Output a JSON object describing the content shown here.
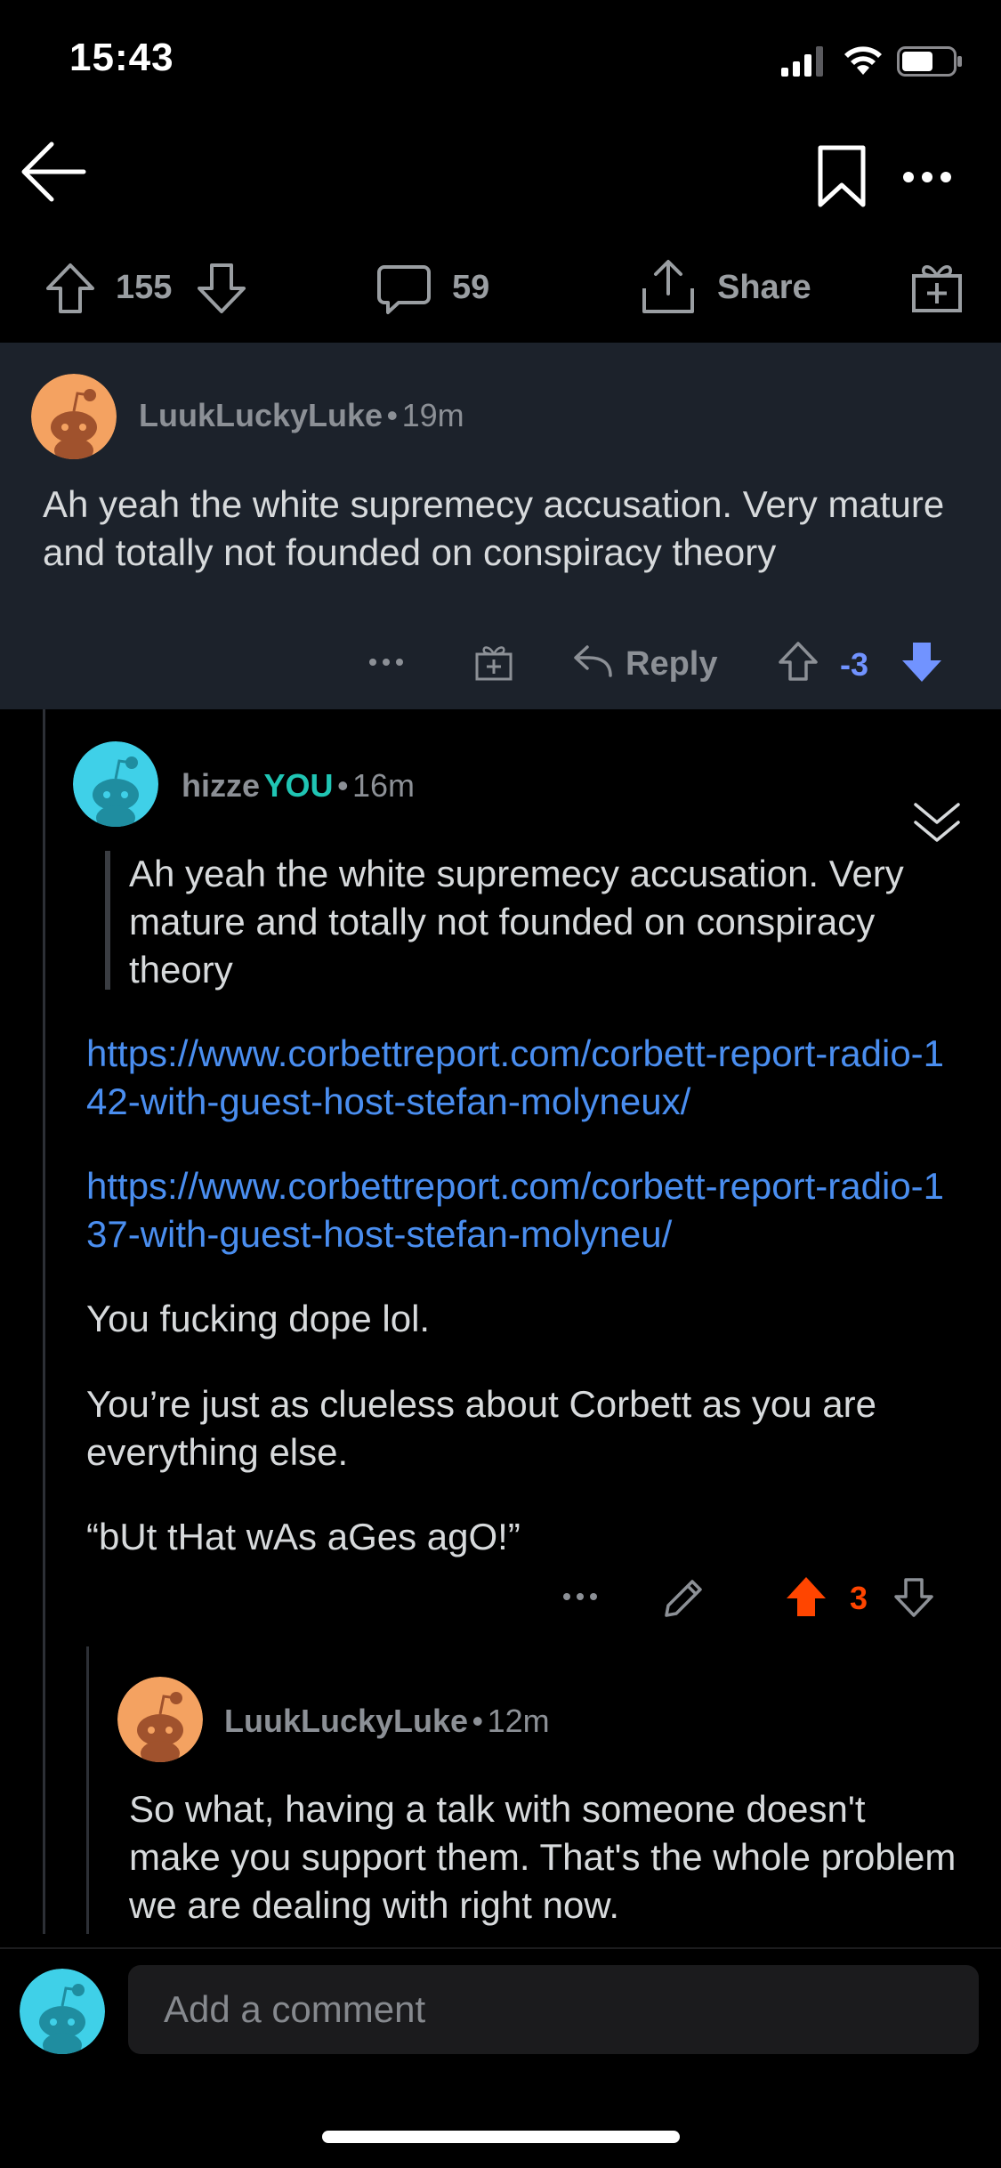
{
  "status_bar": {
    "time": "15:43"
  },
  "action_bar": {
    "upvotes": "155",
    "comments": "59",
    "share_label": "Share"
  },
  "comments": [
    {
      "username": "LuukLuckyLuke",
      "separator": "•",
      "time": "19m",
      "body": "Ah yeah the white supremecy accusation. Very mature and totally not founded on conspiracy theory",
      "reply_label": "Reply",
      "score": "-3",
      "vote_state": "downvoted"
    },
    {
      "username": "hizze",
      "you_badge": "YOU",
      "separator": "•",
      "time": "16m",
      "quote": "Ah yeah the white supremecy accusation. Very mature and totally not founded on conspiracy theory",
      "link1": "https://www.corbettreport.com/corbett-report-radio-142-with-guest-host-stefan-molyneux/",
      "link2": "https://www.corbettreport.com/corbett-report-radio-137-with-guest-host-stefan-molyneu/",
      "para1": "You fucking dope lol.",
      "para2": "You’re just as clueless about Corbett as you are everything else.",
      "para3": "“bUt tHat wAs aGes agO!”",
      "score": "3",
      "vote_state": "upvoted"
    },
    {
      "username": "LuukLuckyLuke",
      "separator": "•",
      "time": "12m",
      "body": "So what, having a talk with someone doesn't make you support them. That's the whole problem we are dealing with right now."
    }
  ],
  "composer": {
    "placeholder": "Add a comment"
  },
  "colors": {
    "upvote_active": "#ff4500",
    "downvote_active": "#7193ff",
    "you_badge": "#20c5b4",
    "link": "#4a8ef0"
  }
}
